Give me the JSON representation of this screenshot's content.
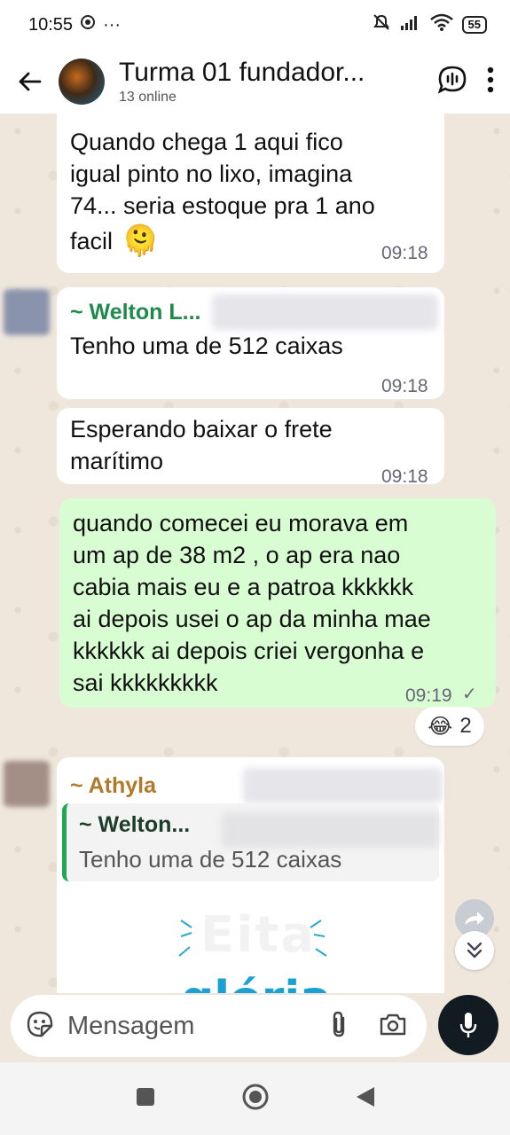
{
  "status_bar": {
    "time": "10:55",
    "dots": "···",
    "battery": "55"
  },
  "header": {
    "title": "Turma 01 fundador...",
    "subtitle": "13 online"
  },
  "messages": [
    {
      "lines": [
        "Quando chega 1 aqui fico",
        "igual pinto no lixo, imagina",
        "74... seria estoque pra 1 ano",
        "facil"
      ],
      "emoji": "🫠",
      "time": "09:18"
    },
    {
      "sender": "~ Welton L...",
      "text": "Tenho uma de 512 caixas",
      "time": "09:18"
    },
    {
      "lines": [
        "Esperando baixar o frete",
        "marítimo"
      ],
      "time": "09:18"
    },
    {
      "lines": [
        "quando comecei eu morava em",
        "um ap de 38 m2 , o ap era nao",
        "cabia mais eu e a patroa kkkkkk",
        "ai depois usei o ap da minha mae",
        "kkkkkk ai depois criei vergonha e",
        "sai kkkkkkkkk"
      ],
      "time": "09:19",
      "tick": "✓",
      "reaction": {
        "emoji": "😂",
        "count": "2"
      }
    },
    {
      "sender": "~ Athyla",
      "quote_sender": "~ Welton...",
      "quote_text": "Tenho uma de 512 caixas",
      "sticker_line1": "Eita",
      "sticker_line2": "glória"
    }
  ],
  "composer": {
    "placeholder": "Mensagem"
  },
  "colors": {
    "sender_welton": "#1f8a4c",
    "sender_athyla": "#b07a2a",
    "outgoing_bubble": "#d9fdd3",
    "quote_bar": "#1fa855"
  },
  "icons": [
    "back-arrow-icon",
    "voice-chat-icon",
    "more-icon",
    "sticker-icon",
    "attach-icon",
    "camera-icon",
    "mic-icon",
    "forward-icon",
    "scroll-down-icon"
  ]
}
